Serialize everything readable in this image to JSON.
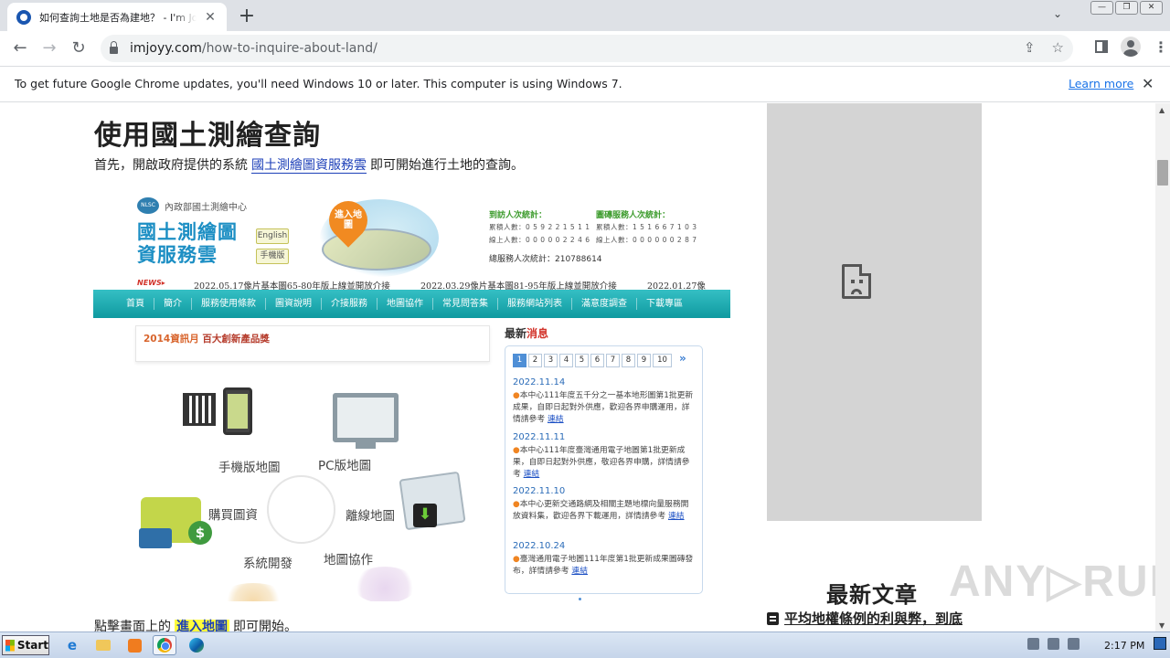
{
  "browser": {
    "tab_title": "如何查詢土地是否為建地？ - I'm Joyy",
    "tab_close": "✕",
    "new_tab": "+",
    "tab_search": "⌄",
    "window_controls": [
      "—",
      "❐",
      "✕"
    ],
    "url_host": "imjoyy.com",
    "url_path": "/how-to-inquire-about-land/",
    "nav": {
      "back": "←",
      "forward": "→",
      "reload": "↻"
    },
    "omnibox_icons": {
      "share": "⇪",
      "bookmark": "☆"
    },
    "menu": "⋮"
  },
  "infobar": {
    "message": "To get future Google Chrome updates, you'll need Windows 10 or later. This computer is using Windows 7.",
    "link": "Learn more",
    "close": "✕"
  },
  "article": {
    "heading": "使用國土測繪查詢",
    "intro_before": "首先，開啟政府提供的系統",
    "intro_link": "國土測繪圖資服務雲",
    "intro_after": "即可開始進行土地的查詢。",
    "step_before": "點擊畫面上的",
    "step_highlight": "進入地圖",
    "step_after": "即可開始。"
  },
  "screenshot": {
    "agency_logo": "NLSC",
    "agency": "內政部國土測繪中心",
    "site_logo": "國土測繪圖資服務雲",
    "lang_english": "English",
    "lang_mobile": "手機版",
    "enter_map": "進入地圖",
    "stats_left_title": "到訪人次統計：",
    "stats_left_line1": "累積人數：0 5 9 2 2 1 5 1 1",
    "stats_left_line2": "線上人數：0 0 0 0 0 2 2 4 6",
    "stats_right_title": "圖磚服務人次統計：",
    "stats_right_line1": "累積人數：1 5 1 6 6 7 1 0 3",
    "stats_right_line2": "線上人數：0 0 0 0 0 0 2 8 7",
    "total": "總服務人次統計：210788614",
    "news_tag": "NEWS▸",
    "ticker": [
      "2022.05.17像片基本圖65-80年版上線並開放介接",
      "2022.03.29像片基本圖81-95年版上線並開放介接",
      "2022.01.27像"
    ],
    "nav_items": [
      "首頁",
      "簡介",
      "服務使用條款",
      "圖資說明",
      "介接服務",
      "地圖協作",
      "常見問答集",
      "服務網站列表",
      "滿意度調查",
      "下載專區"
    ],
    "promo_prefix": "2014資訊月",
    "promo_award": "百大創新產品獎",
    "features": [
      "手機版地圖",
      "PC版地圖",
      "購買圖資",
      "離線地圖",
      "系統開發",
      "地圖協作"
    ],
    "coin_symbol": "$",
    "download_symbol": "⬇",
    "news_head_a": "最新",
    "news_head_b": "消息",
    "pages": [
      "1",
      "2",
      "3",
      "4",
      "5",
      "6",
      "7",
      "8",
      "9",
      "10"
    ],
    "pager_next": "»",
    "news": [
      {
        "date": "2022.11.14",
        "text": "本中心111年度五千分之一基本地形圖第1批更新成果，自即日起對外供應，歡迎各界申購運用，詳情請參考",
        "link": "連結"
      },
      {
        "date": "2022.11.11",
        "text": "本中心111年度臺灣通用電子地圖第1批更新成果，自即日起對外供應，敬迎各界申購，詳情請參考",
        "link": "連結"
      },
      {
        "date": "2022.11.10",
        "text": "本中心更新交通路網及相關主題地標向量服務開放資料集，歡迎各界下載運用，詳情請參考",
        "link": "連結"
      },
      {
        "date": "2022.10.24",
        "text": "臺灣通用電子地圖111年度第1批更新成果圖磚發布，詳情請參考",
        "link": "連結"
      }
    ]
  },
  "sidebar": {
    "recent_title": "最新文章",
    "recent_item": "平均地權條例的利與弊，到底"
  },
  "watermark": "ANY▷RUN",
  "scrollbar": {
    "up": "▲",
    "down": "▼"
  },
  "taskbar": {
    "start": "Start",
    "ie_letter": "e",
    "clock": "2:17 PM"
  }
}
